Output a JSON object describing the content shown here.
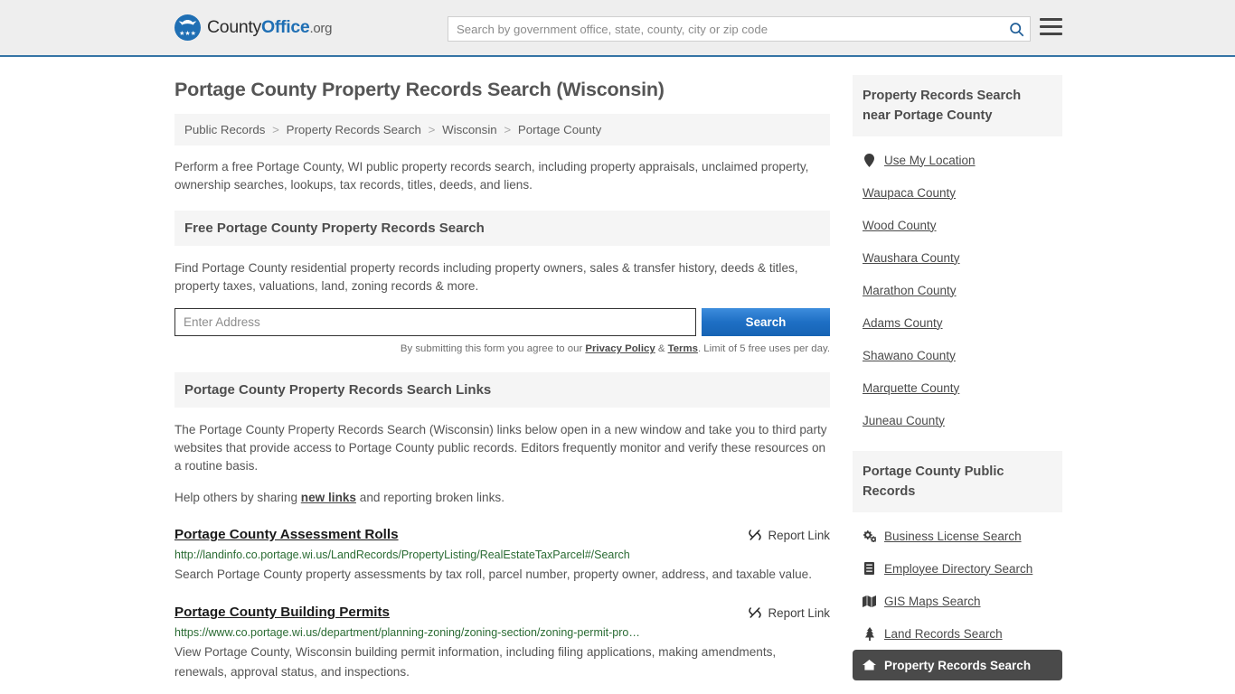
{
  "header": {
    "logo": {
      "part1": "County",
      "part2": "Office",
      "part3": ".org",
      "stars": "★★★"
    },
    "search": {
      "placeholder": "Search by government office, state, county, city or zip code",
      "value": ""
    },
    "search_icon": "search-icon",
    "menu_icon": "hamburger-menu-icon"
  },
  "main": {
    "title": "Portage County Property Records Search (Wisconsin)",
    "breadcrumb": [
      {
        "label": "Public Records"
      },
      {
        "label": "Property Records Search"
      },
      {
        "label": "Wisconsin"
      },
      {
        "label": "Portage County"
      }
    ],
    "breadcrumb_separator": ">",
    "intro": "Perform a free Portage County, WI public property records search, including property appraisals, unclaimed property, ownership searches, lookups, tax records, titles, deeds, and liens.",
    "free_search": {
      "heading": "Free Portage County Property Records Search",
      "description": "Find Portage County residential property records including property owners, sales & transfer history, deeds & titles, property taxes, valuations, land, zoning records & more.",
      "input_placeholder": "Enter Address",
      "input_value": "",
      "submit_label": "Search",
      "disclaimer_pre": "By submitting this form you agree to our ",
      "privacy_label": "Privacy Policy",
      "disclaimer_amp": " & ",
      "terms_label": "Terms",
      "disclaimer_post": ". Limit of 5 free uses per day."
    },
    "links_section": {
      "heading": "Portage County Property Records Search Links",
      "paragraph": "The Portage County Property Records Search (Wisconsin) links below open in a new window and take you to third party websites that provide access to Portage County public records. Editors frequently monitor and verify these resources on a routine basis.",
      "help_pre": "Help others by sharing ",
      "help_link": "new links",
      "help_post": " and reporting broken links.",
      "report_label": "Report Link",
      "report_icon": "unlink-icon"
    },
    "results": [
      {
        "title": "Portage County Assessment Rolls",
        "url": "http://landinfo.co.portage.wi.us/LandRecords/PropertyListing/RealEstateTaxParcel#/Search",
        "description": "Search Portage County property assessments by tax roll, parcel number, property owner, address, and taxable value.",
        "report_label": "Report Link"
      },
      {
        "title": "Portage County Building Permits",
        "url": "https://www.co.portage.wi.us/department/planning-zoning/zoning-section/zoning-permit-pro…",
        "description": "View Portage County, Wisconsin building permit information, including filing applications, making amendments, renewals, approval status, and inspections.",
        "report_label": "Report Link"
      }
    ]
  },
  "sidebar": {
    "nearby": {
      "heading": "Property Records Search near Portage County",
      "items": [
        {
          "label": "Use My Location",
          "icon": "map-pin-icon"
        },
        {
          "label": "Waupaca County",
          "icon": ""
        },
        {
          "label": "Wood County",
          "icon": ""
        },
        {
          "label": "Waushara County",
          "icon": ""
        },
        {
          "label": "Marathon County",
          "icon": ""
        },
        {
          "label": "Adams County",
          "icon": ""
        },
        {
          "label": "Shawano County",
          "icon": ""
        },
        {
          "label": "Marquette County",
          "icon": ""
        },
        {
          "label": "Juneau County",
          "icon": ""
        }
      ]
    },
    "public_records": {
      "heading": "Portage County Public Records",
      "items": [
        {
          "label": "Business License Search",
          "icon": "cogs-icon",
          "active": false
        },
        {
          "label": "Employee Directory Search",
          "icon": "book-icon",
          "active": false
        },
        {
          "label": "GIS Maps Search",
          "icon": "map-icon",
          "active": false
        },
        {
          "label": "Land Records Search",
          "icon": "tree-icon",
          "active": false
        },
        {
          "label": "Property Records Search",
          "icon": "home-icon",
          "active": true
        }
      ]
    }
  },
  "colors": {
    "brand_blue": "#1f6fb4",
    "header_bg": "#eeeeee",
    "header_border": "#3574a5",
    "section_bg": "#f5f5f5",
    "url_green": "#2a6b33",
    "active_bg": "#4a4a4a"
  }
}
